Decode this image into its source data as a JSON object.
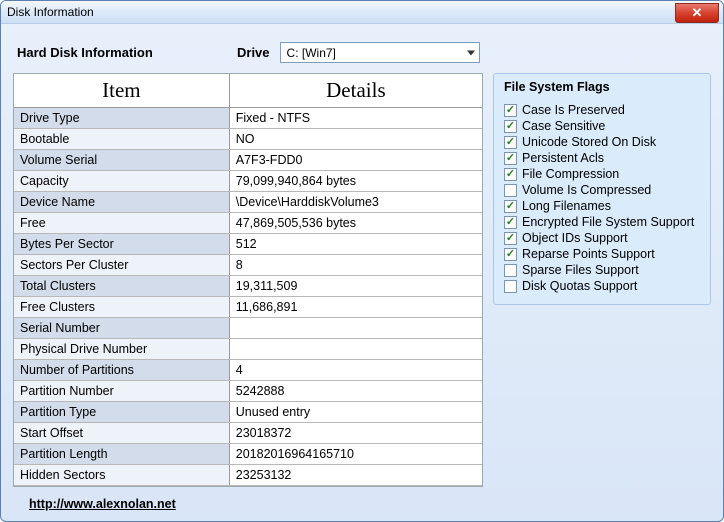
{
  "window": {
    "title": "Disk Information"
  },
  "topbar": {
    "hdi_label": "Hard Disk Information",
    "drive_label": "Drive",
    "drive_value": "C: [Win7]"
  },
  "table": {
    "headers": {
      "item": "Item",
      "details": "Details"
    },
    "rows": [
      {
        "label": "Drive Type",
        "value": "Fixed - NTFS"
      },
      {
        "label": "Bootable",
        "value": "NO"
      },
      {
        "label": "Volume Serial",
        "value": "A7F3-FDD0"
      },
      {
        "label": "Capacity",
        "value": "79,099,940,864 bytes"
      },
      {
        "label": "Device Name",
        "value": "\\Device\\HarddiskVolume3"
      },
      {
        "label": "Free",
        "value": "47,869,505,536 bytes"
      },
      {
        "label": "Bytes Per Sector",
        "value": "512"
      },
      {
        "label": "Sectors Per Cluster",
        "value": "8"
      },
      {
        "label": "Total Clusters",
        "value": "19,311,509"
      },
      {
        "label": "Free Clusters",
        "value": "11,686,891"
      },
      {
        "label": "Serial Number",
        "value": ""
      },
      {
        "label": "Physical Drive Number",
        "value": ""
      },
      {
        "label": "Number of Partitions",
        "value": "4"
      },
      {
        "label": "Partition Number",
        "value": "5242888"
      },
      {
        "label": "Partition Type",
        "value": "Unused entry"
      },
      {
        "label": "Start Offset",
        "value": "23018372"
      },
      {
        "label": "Partition Length",
        "value": "20182016964165710"
      },
      {
        "label": "Hidden Sectors",
        "value": "23253132"
      }
    ]
  },
  "flags": {
    "title": "File System Flags",
    "items": [
      {
        "label": "Case Is Preserved",
        "checked": true
      },
      {
        "label": "Case Sensitive",
        "checked": true
      },
      {
        "label": "Unicode Stored On Disk",
        "checked": true
      },
      {
        "label": "Persistent Acls",
        "checked": true
      },
      {
        "label": "File Compression",
        "checked": true
      },
      {
        "label": "Volume Is Compressed",
        "checked": false
      },
      {
        "label": "Long Filenames",
        "checked": true
      },
      {
        "label": "Encrypted File System Support",
        "checked": true
      },
      {
        "label": "Object IDs Support",
        "checked": true
      },
      {
        "label": "Reparse Points Support",
        "checked": true
      },
      {
        "label": "Sparse Files Support",
        "checked": false
      },
      {
        "label": "Disk Quotas Support",
        "checked": false
      }
    ]
  },
  "footer": {
    "url_text": "http://www.alexnolan.net"
  }
}
